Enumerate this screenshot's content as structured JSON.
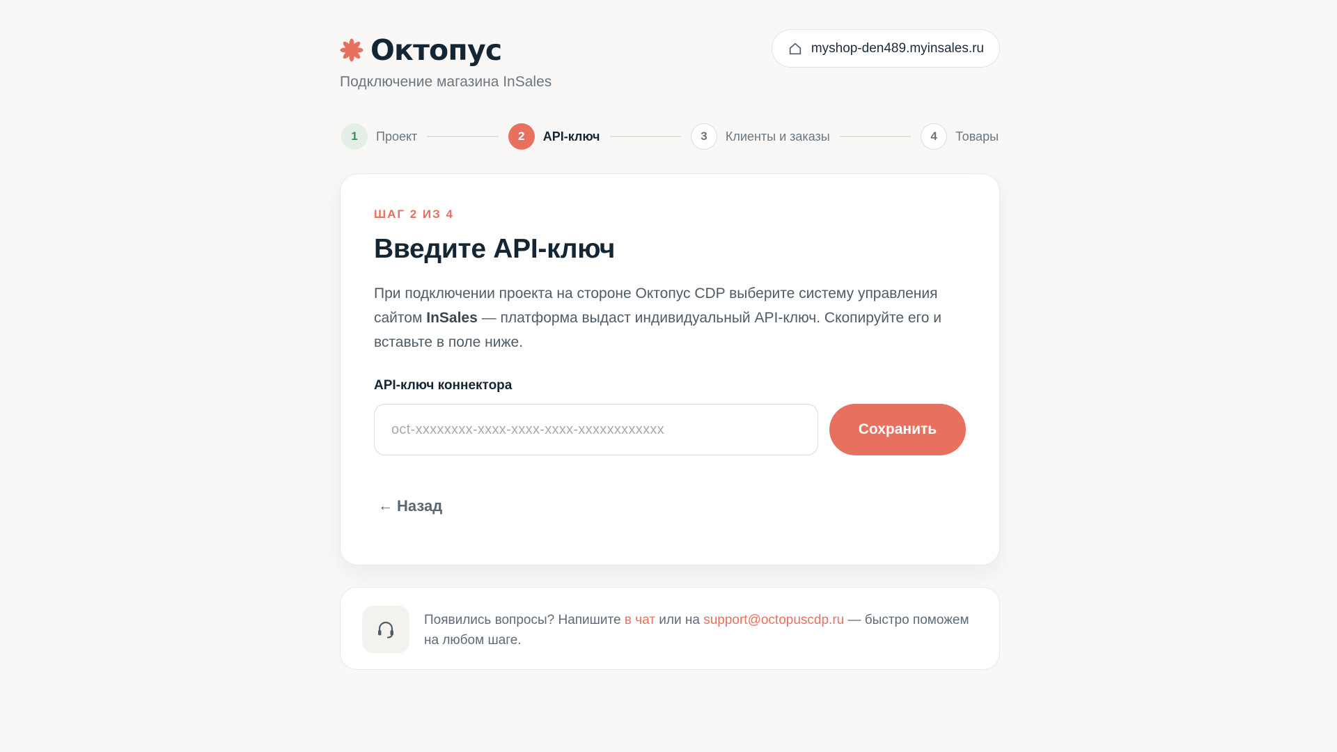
{
  "brand": {
    "name": "Октопус",
    "subtitle": "Подключение магазина InSales"
  },
  "shop": {
    "domain": "myshop-den489.myinsales.ru",
    "icon": "home-icon"
  },
  "stepper": {
    "steps": [
      {
        "number": "1",
        "label": "Проект",
        "state": "done"
      },
      {
        "number": "2",
        "label": "API-ключ",
        "state": "active"
      },
      {
        "number": "3",
        "label": "Клиенты и заказы",
        "state": "todo"
      },
      {
        "number": "4",
        "label": "Товары",
        "state": "todo"
      }
    ]
  },
  "card": {
    "eyebrow": "ШАГ 2 ИЗ 4",
    "title": "Введите API-ключ",
    "desc_part1": "При подключении проекта на стороне Октопус CDP выберите систему управления сайтом ",
    "desc_bold": "InSales",
    "desc_part2": " — платформа выдаст индивидуальный API-ключ. Скопируйте его и вставьте в поле ниже.",
    "field_label": "API-ключ коннектора",
    "input_placeholder": "oct-xxxxxxxx-xxxx-xxxx-xxxx-xxxxxxxxxxxx",
    "input_value": "",
    "save_label": "Сохранить",
    "back_arrow": "←",
    "back_label": "Назад"
  },
  "support": {
    "icon": "headset-icon",
    "text_part1": "Появились вопросы? Напишите ",
    "chat_link": "в чат",
    "text_part2": " или на ",
    "email_link": "support@octopuscdp.ru",
    "text_part3": " — быстро поможем на любом шаге."
  },
  "colors": {
    "accent": "#e8705f",
    "done_bg": "#e3efe7",
    "done_text": "#3f8a5a",
    "background": "#f9f8f7"
  }
}
